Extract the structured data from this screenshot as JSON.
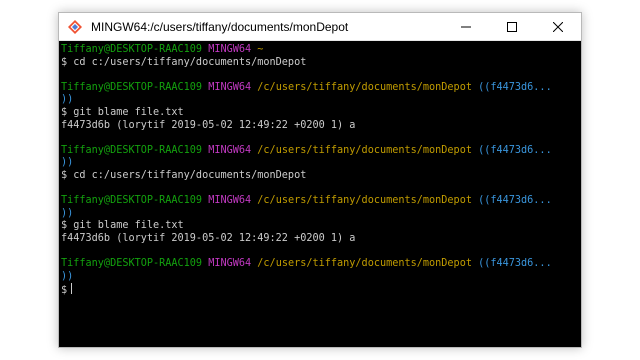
{
  "window": {
    "title": "MINGW64:/c/users/tiffany/documents/monDepot",
    "icon": "git-bash-icon",
    "controls": [
      "minimize-icon",
      "maximize-icon",
      "close-icon"
    ]
  },
  "colors": {
    "user_host": "#13a10e",
    "system": "#c239c2",
    "path": "#c19c00",
    "branch": "#3a96dd",
    "text": "#cccccc",
    "background": "#000000"
  },
  "terminal": {
    "lines": [
      {
        "segments": [
          {
            "text": "Tiffany@DESKTOP-RAAC109",
            "color": "green"
          },
          {
            "text": " ",
            "color": "white"
          },
          {
            "text": "MINGW64",
            "color": "magenta"
          },
          {
            "text": " ~",
            "color": "yellow"
          }
        ]
      },
      {
        "segments": [
          {
            "text": "$ cd c:/users/tiffany/documents/monDepot",
            "color": "white"
          }
        ]
      },
      {
        "segments": [
          {
            "text": "",
            "color": "white"
          }
        ]
      },
      {
        "segments": [
          {
            "text": "Tiffany@DESKTOP-RAAC109",
            "color": "green"
          },
          {
            "text": " ",
            "color": "white"
          },
          {
            "text": "MINGW64",
            "color": "magenta"
          },
          {
            "text": " /c/users/tiffany/documents/monDepot",
            "color": "yellow"
          },
          {
            "text": " ((f4473d6...",
            "color": "cyan"
          }
        ]
      },
      {
        "segments": [
          {
            "text": "))",
            "color": "cyan"
          }
        ]
      },
      {
        "segments": [
          {
            "text": "$ git blame file.txt",
            "color": "white"
          }
        ]
      },
      {
        "segments": [
          {
            "text": "f4473d6b (lorytif 2019-05-02 12:49:22 +0200 1) a",
            "color": "white"
          }
        ]
      },
      {
        "segments": [
          {
            "text": "",
            "color": "white"
          }
        ]
      },
      {
        "segments": [
          {
            "text": "Tiffany@DESKTOP-RAAC109",
            "color": "green"
          },
          {
            "text": " ",
            "color": "white"
          },
          {
            "text": "MINGW64",
            "color": "magenta"
          },
          {
            "text": " /c/users/tiffany/documents/monDepot",
            "color": "yellow"
          },
          {
            "text": " ((f4473d6...",
            "color": "cyan"
          }
        ]
      },
      {
        "segments": [
          {
            "text": "))",
            "color": "cyan"
          }
        ]
      },
      {
        "segments": [
          {
            "text": "$ cd c:/users/tiffany/documents/monDepot",
            "color": "white"
          }
        ]
      },
      {
        "segments": [
          {
            "text": "",
            "color": "white"
          }
        ]
      },
      {
        "segments": [
          {
            "text": "Tiffany@DESKTOP-RAAC109",
            "color": "green"
          },
          {
            "text": " ",
            "color": "white"
          },
          {
            "text": "MINGW64",
            "color": "magenta"
          },
          {
            "text": " /c/users/tiffany/documents/monDepot",
            "color": "yellow"
          },
          {
            "text": " ((f4473d6...",
            "color": "cyan"
          }
        ]
      },
      {
        "segments": [
          {
            "text": "))",
            "color": "cyan"
          }
        ]
      },
      {
        "segments": [
          {
            "text": "$ git blame file.txt",
            "color": "white"
          }
        ]
      },
      {
        "segments": [
          {
            "text": "f4473d6b (lorytif 2019-05-02 12:49:22 +0200 1) a",
            "color": "white"
          }
        ]
      },
      {
        "segments": [
          {
            "text": "",
            "color": "white"
          }
        ]
      },
      {
        "segments": [
          {
            "text": "Tiffany@DESKTOP-RAAC109",
            "color": "green"
          },
          {
            "text": " ",
            "color": "white"
          },
          {
            "text": "MINGW64",
            "color": "magenta"
          },
          {
            "text": " /c/users/tiffany/documents/monDepot",
            "color": "yellow"
          },
          {
            "text": " ((f4473d6...",
            "color": "cyan"
          }
        ]
      },
      {
        "segments": [
          {
            "text": "))",
            "color": "cyan"
          }
        ]
      },
      {
        "segments": [
          {
            "text": "$",
            "color": "white"
          }
        ],
        "cursor": true
      }
    ]
  }
}
